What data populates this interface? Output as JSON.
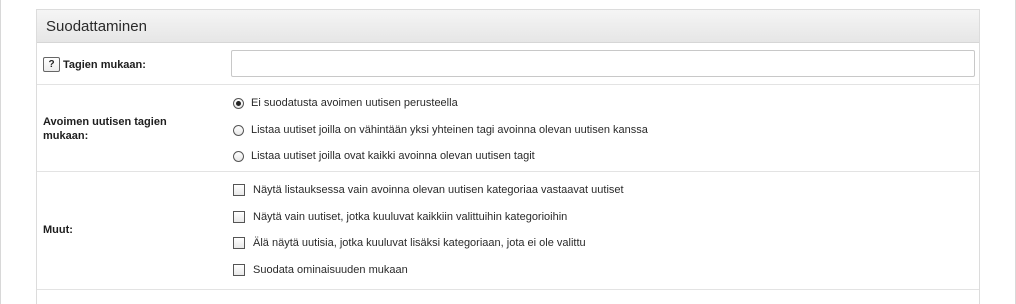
{
  "panel": {
    "title": "Suodattaminen"
  },
  "tags_filter": {
    "label": "Tagien mukaan:",
    "help_icon_text": "?",
    "value": "",
    "placeholder": ""
  },
  "open_news_filter": {
    "label": "Avoimen uutisen tagien mukaan:",
    "options": [
      {
        "label": "Ei suodatusta avoimen uutisen perusteella",
        "checked": true
      },
      {
        "label": "Listaa uutiset joilla on vähintään yksi yhteinen tagi avoinna olevan uutisen kanssa",
        "checked": false
      },
      {
        "label": "Listaa uutiset joilla ovat kaikki avoinna olevan uutisen tagit",
        "checked": false
      }
    ]
  },
  "misc": {
    "label": "Muut:",
    "options": [
      {
        "label": "Näytä listauksessa vain avoinna olevan uutisen kategoriaa vastaavat uutiset",
        "checked": false
      },
      {
        "label": "Näytä vain uutiset, jotka kuuluvat kaikkiin valittuihin kategorioihin",
        "checked": false
      },
      {
        "label": "Älä näytä uutisia, jotka kuuluvat lisäksi kategoriaan, jota ei ole valittu",
        "checked": false
      },
      {
        "label": "Suodata ominaisuuden mukaan",
        "checked": false
      }
    ]
  }
}
